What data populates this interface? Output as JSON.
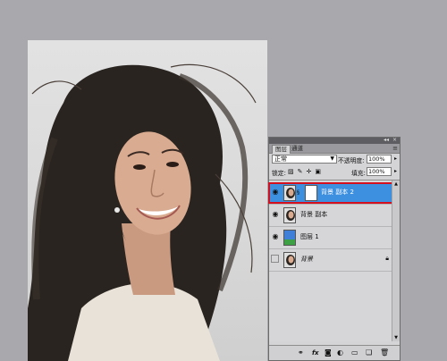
{
  "panel": {
    "tabs": [
      {
        "label": "图层"
      },
      {
        "label": "通道"
      }
    ],
    "blend_mode": "正常",
    "opacity_label": "不透明度:",
    "opacity_value": "100%",
    "lock_label": "锁定:",
    "fill_label": "填充:",
    "fill_value": "100%",
    "layers": [
      {
        "name": "背景 副本 2",
        "visible": true,
        "selected": true,
        "has_mask": true
      },
      {
        "name": "背景 副本",
        "visible": true,
        "selected": false
      },
      {
        "name": "图层 1",
        "visible": true,
        "selected": false
      },
      {
        "name": "背景",
        "visible": false,
        "selected": false,
        "locked": true
      }
    ]
  },
  "icons": {
    "eye": "eye-icon",
    "lock": "lock-icon",
    "chain": "chain-link-icon",
    "bottom": [
      "link-layers-icon",
      "fx-icon",
      "add-mask-icon",
      "adjustment-layer-icon",
      "new-group-icon",
      "new-layer-icon",
      "trash-icon"
    ]
  },
  "colors": {
    "selected_layer": "#3d8fe0",
    "highlight_box": "#d40f1e",
    "workspace_bg": "#a9a8ad"
  }
}
